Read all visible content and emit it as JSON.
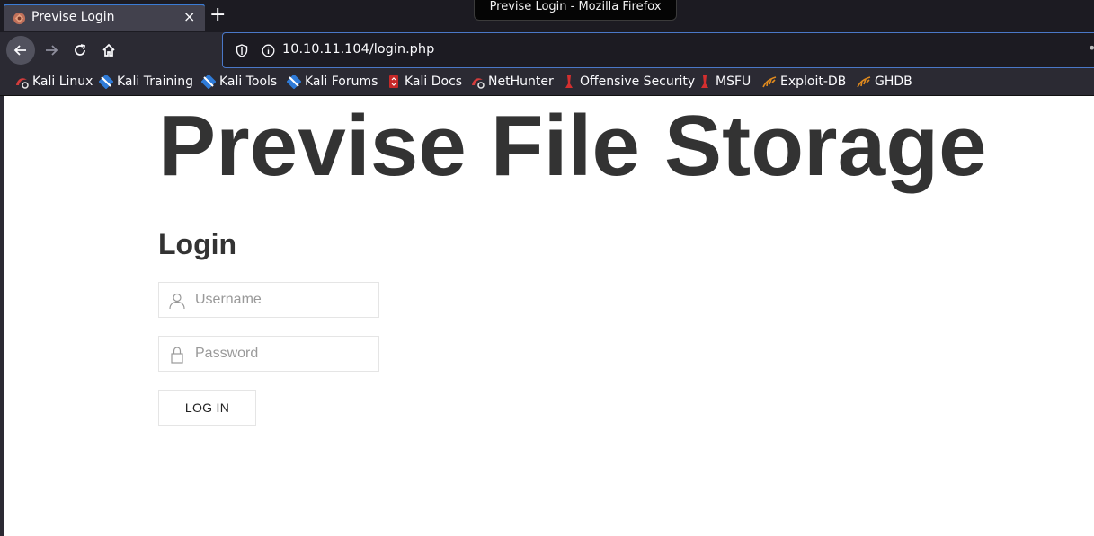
{
  "browser": {
    "window_title": "Previse Login - Mozilla Firefox",
    "tab": {
      "title": "Previse Login",
      "close": "×"
    },
    "new_tab": "+",
    "url": "10.10.11.104/login.php",
    "bookmarks": [
      {
        "label": "Kali Linux",
        "icon": "kali-logo-icon"
      },
      {
        "label": "Kali Training",
        "icon": "kali-training-icon"
      },
      {
        "label": "Kali Tools",
        "icon": "kali-tools-icon"
      },
      {
        "label": "Kali Forums",
        "icon": "kali-forums-icon"
      },
      {
        "label": "Kali Docs",
        "icon": "kali-docs-icon"
      },
      {
        "label": "NetHunter",
        "icon": "nethunter-icon"
      },
      {
        "label": "Offensive Security",
        "icon": "offsec-icon"
      },
      {
        "label": "MSFU",
        "icon": "msfu-icon"
      },
      {
        "label": "Exploit-DB",
        "icon": "exploit-db-icon"
      },
      {
        "label": "GHDB",
        "icon": "ghdb-icon"
      }
    ]
  },
  "page": {
    "title": "Previse File Storage",
    "login_heading": "Login",
    "username_placeholder": "Username",
    "password_placeholder": "Password",
    "login_button": "LOG IN"
  },
  "colors": {
    "chrome_dark": "#1c1b22",
    "toolbar": "#2b2a33",
    "url_focus": "#4a78c8",
    "text_dark": "#333333"
  }
}
